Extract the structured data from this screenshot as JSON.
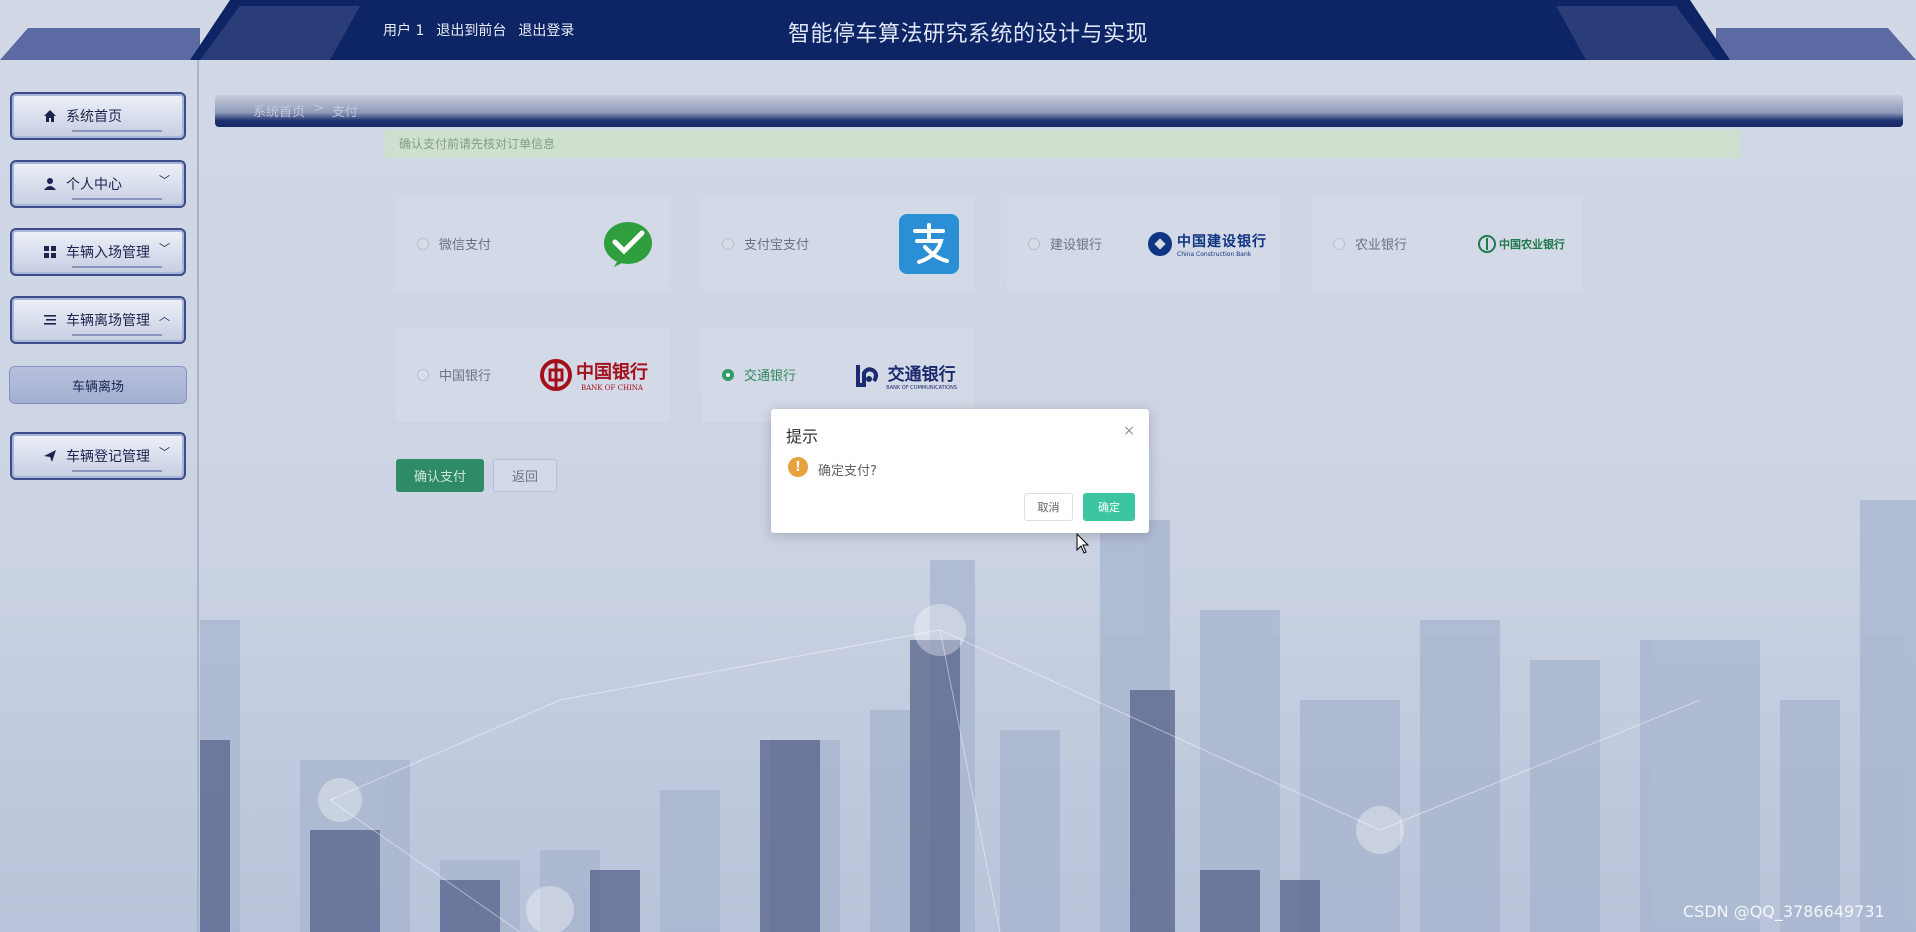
{
  "header": {
    "user_label": "用户 1",
    "front_link": "退出到前台",
    "logout_link": "退出登录",
    "title": "智能停车算法研究系统的设计与实现"
  },
  "sidebar": {
    "items": [
      {
        "label": "系统首页",
        "icon": "home-icon"
      },
      {
        "label": "个人中心",
        "icon": "user-icon"
      },
      {
        "label": "车辆入场管理",
        "icon": "grid-icon"
      },
      {
        "label": "车辆离场管理",
        "icon": "list-icon"
      },
      {
        "label": "车辆离场",
        "icon": ""
      },
      {
        "label": "车辆登记管理",
        "icon": "send-icon"
      }
    ]
  },
  "breadcrumb": {
    "home": "系统首页",
    "sep": ">",
    "current": "支付"
  },
  "tip": "确认支付前请先核对订单信息",
  "payment_methods": [
    {
      "name": "微信支付",
      "logo": "wechat-pay-logo",
      "selected": false
    },
    {
      "name": "支付宝支付",
      "logo": "alipay-logo",
      "selected": false
    },
    {
      "name": "建设银行",
      "logo": "ccb-logo",
      "selected": false
    },
    {
      "name": "农业银行",
      "logo": "abc-logo",
      "selected": false
    },
    {
      "name": "中国银行",
      "logo": "boc-logo",
      "selected": false
    },
    {
      "name": "交通银行",
      "logo": "bocom-logo",
      "selected": true
    }
  ],
  "bank_logo_text": {
    "ccb": "中国建设银行",
    "ccb_en": "China Construction Bank",
    "abc": "中国农业银行",
    "boc": "中国银行",
    "boc_en": "BANK OF CHINA",
    "bocom": "交通银行",
    "bocom_en": "BANK OF COMMUNICATIONS"
  },
  "actions": {
    "confirm": "确认支付",
    "back": "返回"
  },
  "dialog": {
    "title": "提示",
    "close": "×",
    "message": "确定支付?",
    "cancel": "取消",
    "ok": "确定"
  },
  "watermark": "CSDN @QQ_3786649731",
  "colors": {
    "header": "#0d2566",
    "accent": "#2f8a66",
    "dialog_ok": "#3cc6a0",
    "warning": "#e6a23c"
  }
}
